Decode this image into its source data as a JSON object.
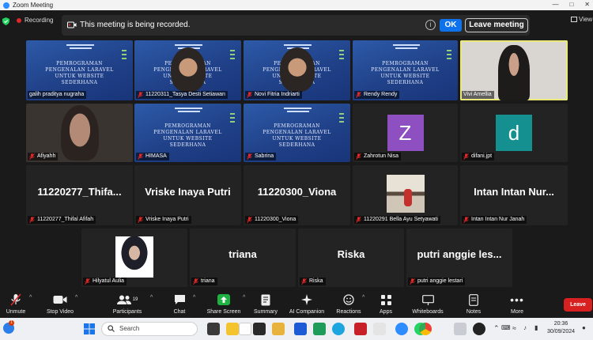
{
  "window": {
    "title": "Zoom Meeting"
  },
  "topbar": {
    "recording_label": "Recording",
    "banner_message": "This meeting is being recorded.",
    "info_symbol": "i",
    "ok_label": "OK",
    "leave_meeting_label": "Leave meeting",
    "view_label": "View"
  },
  "slide": {
    "title_line1": "PEMROGRAMAN",
    "title_line2": "PENGENALAN LARAVEL UNTUK WEBSITE",
    "title_line3": "SEDERHANA"
  },
  "participants": [
    {
      "name": "galih praditya nugraha",
      "muted": false,
      "view": "slide"
    },
    {
      "name": "11220311_Tasya Desti Setiawan",
      "muted": true,
      "view": "slide-with-camera"
    },
    {
      "name": "Novi Fitria Indriarti",
      "muted": true,
      "view": "slide-with-camera"
    },
    {
      "name": "Rendy Rendy",
      "muted": true,
      "view": "slide"
    },
    {
      "name": "Vivi Amellia",
      "muted": false,
      "view": "camera",
      "active_speaker": true
    },
    {
      "name": "Afiyahh",
      "muted": true,
      "view": "camera"
    },
    {
      "name": "HIMASA",
      "muted": true,
      "view": "slide"
    },
    {
      "name": "Sabrina",
      "muted": true,
      "view": "slide"
    },
    {
      "name": "Zahrotun Nisa",
      "muted": true,
      "view": "avatar",
      "avatar_letter": "Z",
      "avatar_color": "#8e4fc0"
    },
    {
      "name": "difani.jpt",
      "muted": true,
      "view": "avatar",
      "avatar_letter": "d",
      "avatar_color": "#159090"
    },
    {
      "name": "11220277_Thifal Afifah",
      "muted": true,
      "view": "name",
      "display_name": "11220277_Thifa..."
    },
    {
      "name": "Vriske Inaya Putri",
      "muted": true,
      "view": "name",
      "display_name": "Vriske Inaya Putri"
    },
    {
      "name": "11220300_Viona",
      "muted": true,
      "view": "name",
      "display_name": "11220300_Viona"
    },
    {
      "name": "11220291 Bella Ayu Setyawati",
      "muted": true,
      "view": "photo"
    },
    {
      "name": "Intan Intan Nur Janah",
      "muted": true,
      "view": "name",
      "display_name": "Intan Intan Nur..."
    },
    {
      "name": "Hilyatul Aulia",
      "muted": true,
      "view": "photo"
    },
    {
      "name": "triana",
      "muted": true,
      "view": "name",
      "display_name": "triana"
    },
    {
      "name": "Riska",
      "muted": true,
      "view": "name",
      "display_name": "Riska"
    },
    {
      "name": "putri anggie lestari",
      "muted": true,
      "view": "name",
      "display_name": "putri anggie les..."
    }
  ],
  "toolbar": {
    "unmute": "Unmute",
    "stop_video": "Stop Video",
    "participants": "Participants",
    "participant_count": "19",
    "chat": "Chat",
    "share_screen": "Share Screen",
    "summary": "Summary",
    "ai_companion": "AI Companion",
    "reactions": "Reactions",
    "apps": "Apps",
    "whiteboards": "Whiteboards",
    "notes": "Notes",
    "more": "More",
    "leave": "Leave",
    "caret": "^"
  },
  "taskbar": {
    "weather_badge": "1",
    "search_placeholder": "Search",
    "time": "20:36",
    "date": "30/09/2024"
  },
  "colors": {
    "share_screen_green": "#1fb141",
    "leave_red": "#d92020",
    "active_speaker_outline": "#ebe87a",
    "ok_blue": "#0e72ed",
    "recording_red": "#e02828"
  }
}
